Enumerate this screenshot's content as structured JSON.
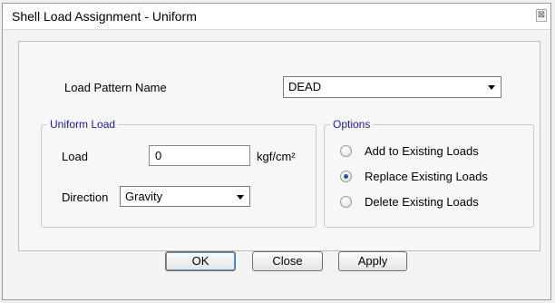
{
  "window": {
    "title": "Shell Load Assignment - Uniform",
    "close_glyph": "⊠"
  },
  "load_pattern": {
    "label": "Load Pattern Name",
    "value": "DEAD"
  },
  "uniform_load": {
    "legend": "Uniform Load",
    "load_label": "Load",
    "load_value": "0",
    "unit": "kgf/cm²",
    "direction_label": "Direction",
    "direction_value": "Gravity"
  },
  "options": {
    "legend": "Options",
    "items": [
      {
        "label": "Add to Existing Loads",
        "checked": false
      },
      {
        "label": "Replace Existing Loads",
        "checked": true
      },
      {
        "label": "Delete Existing Loads",
        "checked": false
      }
    ]
  },
  "buttons": {
    "ok": "OK",
    "close": "Close",
    "apply": "Apply"
  }
}
